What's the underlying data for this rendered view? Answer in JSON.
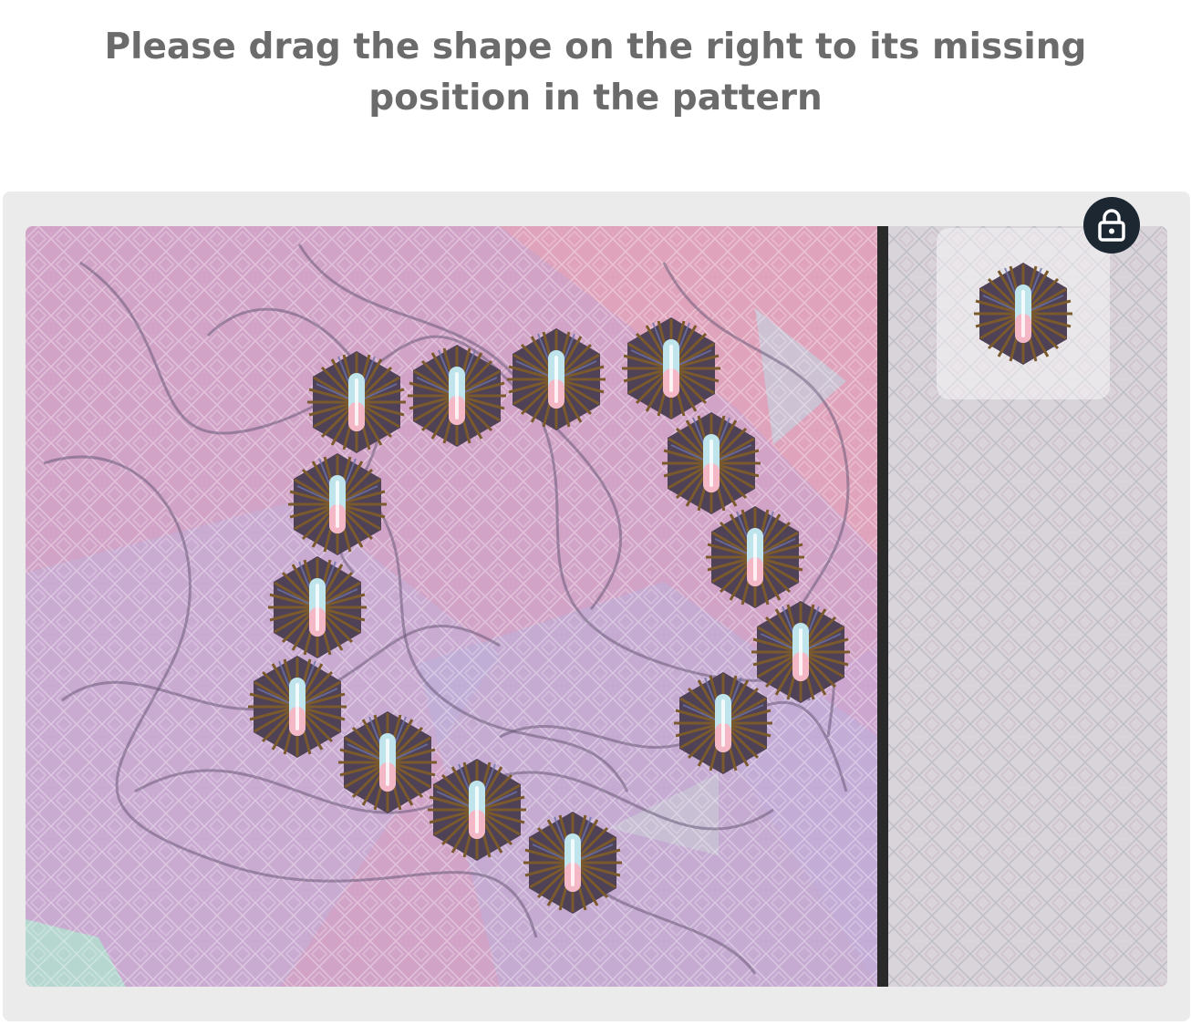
{
  "instruction": {
    "text": "Please drag the shape on the right to its missing position in the pattern"
  },
  "icons": {
    "lock": "lock-icon",
    "piece": "hexagon-burst-icon"
  },
  "colors": {
    "text": "#6b6b6b",
    "frame": "#ebebeb",
    "lock_button": "#1c2732",
    "divider": "#2a2a2a",
    "shape_dark": "#5a4a3a",
    "shape_light_a": "#bfe4ec",
    "shape_light_b": "#f3b7c6"
  }
}
